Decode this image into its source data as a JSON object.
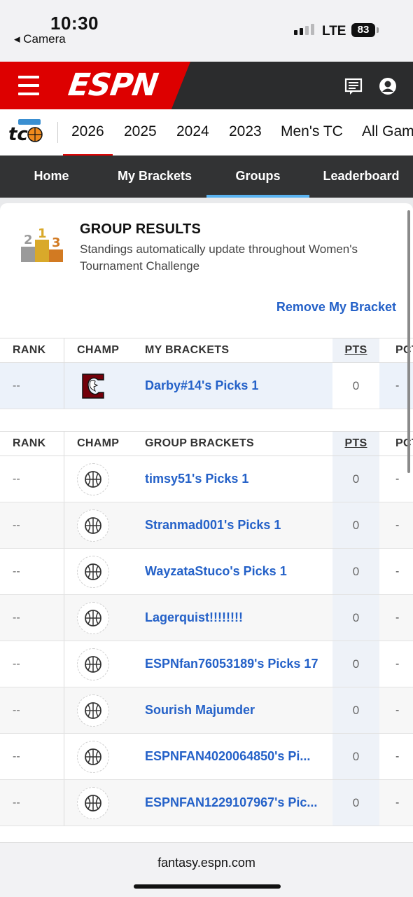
{
  "status": {
    "time": "10:30",
    "back_app": "◂ Camera",
    "network": "LTE",
    "battery": "83"
  },
  "header": {
    "logo": "ESPN",
    "menu_icon": "hamburger-icon",
    "messages_icon": "messages-icon",
    "profile_icon": "profile-icon",
    "brand_color": "#dd0000"
  },
  "years": {
    "logo_alt": "Women's TC",
    "tabs": [
      "2026",
      "2025",
      "2024",
      "2023",
      "Men's TC",
      "All Gam"
    ],
    "active": "2026"
  },
  "nav": {
    "tabs": [
      "Home",
      "My Brackets",
      "Groups",
      "Leaderboard"
    ],
    "active": "Groups"
  },
  "group_results": {
    "title": "GROUP RESULTS",
    "subtitle": "Standings automatically update throughout Women's Tournament Challenge",
    "remove_link": "Remove My Bracket"
  },
  "my_table": {
    "headers": {
      "rank": "RANK",
      "champ": "CHAMP",
      "name": "MY BRACKETS",
      "pts": "PTS",
      "pct": "PCT"
    },
    "rows": [
      {
        "rank": "--",
        "champ_icon": "south-carolina-gamecock-logo",
        "name": "Darby#14's Picks 1",
        "pts": "0",
        "pct": "-"
      }
    ]
  },
  "group_table": {
    "headers": {
      "rank": "RANK",
      "champ": "CHAMP",
      "name": "GROUP BRACKETS",
      "pts": "PTS",
      "pct": "PCT"
    },
    "rows": [
      {
        "rank": "--",
        "champ_icon": "basketball-icon",
        "name": "timsy51's Picks 1",
        "pts": "0",
        "pct": "-"
      },
      {
        "rank": "--",
        "champ_icon": "basketball-icon",
        "name": "Stranmad001's Picks 1",
        "pts": "0",
        "pct": "-"
      },
      {
        "rank": "--",
        "champ_icon": "basketball-icon",
        "name": "WayzataStuco's Picks 1",
        "pts": "0",
        "pct": "-"
      },
      {
        "rank": "--",
        "champ_icon": "basketball-icon",
        "name": "Lagerquist!!!!!!!!",
        "pts": "0",
        "pct": "-"
      },
      {
        "rank": "--",
        "champ_icon": "basketball-icon",
        "name": "ESPNfan76053189's Picks 17",
        "pts": "0",
        "pct": "-"
      },
      {
        "rank": "--",
        "champ_icon": "basketball-icon",
        "name": "Sourish Majumder",
        "pts": "0",
        "pct": "-"
      },
      {
        "rank": "--",
        "champ_icon": "basketball-icon",
        "name": "ESPNFAN4020064850's Pi...",
        "pts": "0",
        "pct": "-"
      },
      {
        "rank": "--",
        "champ_icon": "basketball-icon",
        "name": "ESPNFAN1229107967's Pic...",
        "pts": "0",
        "pct": "-"
      }
    ]
  },
  "browser": {
    "url": "fantasy.espn.com"
  }
}
